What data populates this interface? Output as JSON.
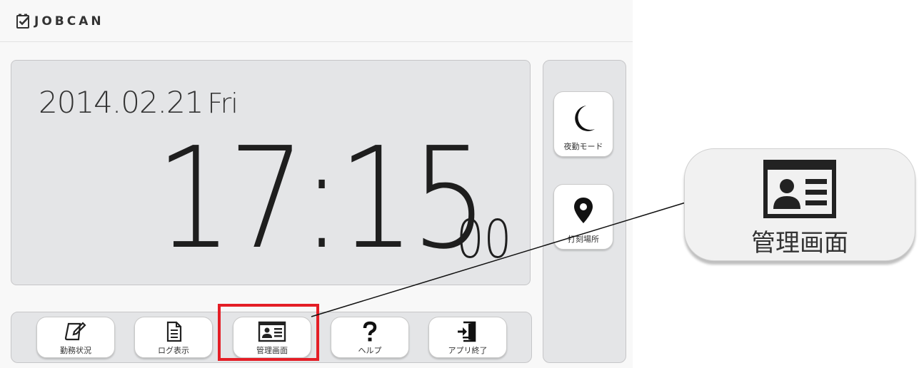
{
  "header": {
    "logo_text": "JOBCAN"
  },
  "clock": {
    "date": "2014.02.21",
    "weekday": "Fri",
    "time": "17:15",
    "seconds": "00"
  },
  "side_buttons": [
    {
      "label": "夜勤モード",
      "icon": "moon-icon"
    },
    {
      "label": "打刻場所",
      "icon": "map-pin-icon"
    }
  ],
  "bottom_buttons": [
    {
      "label": "勤務状況",
      "icon": "edit-note-icon"
    },
    {
      "label": "ログ表示",
      "icon": "document-icon"
    },
    {
      "label": "管理画面",
      "icon": "id-card-icon"
    },
    {
      "label": "ヘルプ",
      "icon": "question-icon"
    },
    {
      "label": "アプリ終了",
      "icon": "exit-icon"
    }
  ],
  "callout": {
    "label": "管理画面",
    "icon": "id-card-icon",
    "highlight_color": "#e41e26"
  }
}
